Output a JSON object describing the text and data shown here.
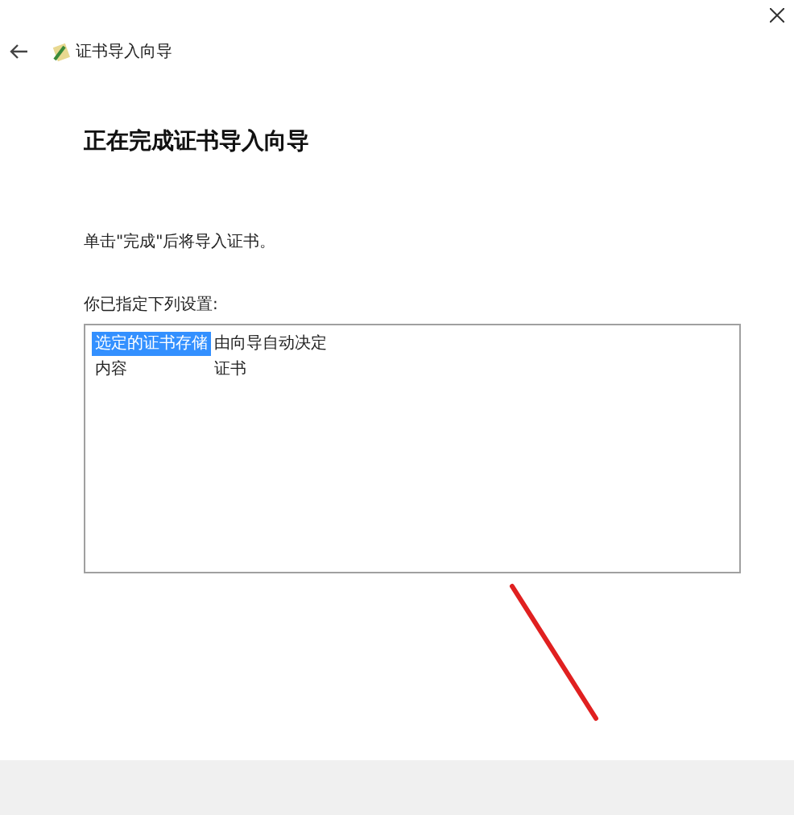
{
  "window": {
    "title": "证书导入向导"
  },
  "heading": "正在完成证书导入向导",
  "message": "单击\"完成\"后将导入证书。",
  "settings": {
    "label": "你已指定下列设置:",
    "rows": [
      {
        "name": "选定的证书存储",
        "value": "由向导自动决定",
        "selected": true
      },
      {
        "name": "内容",
        "value": "证书",
        "selected": false
      }
    ]
  }
}
